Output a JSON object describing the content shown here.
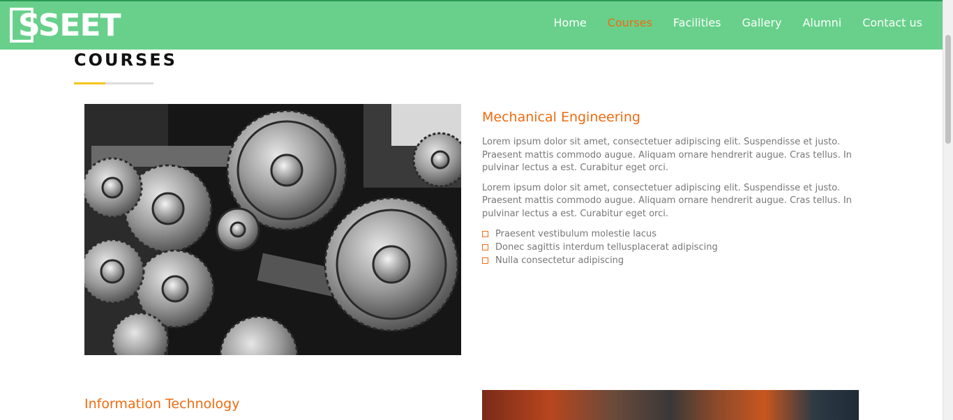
{
  "brand": {
    "logo_text": "SSEET"
  },
  "nav": {
    "items": [
      {
        "label": "Home",
        "active": false
      },
      {
        "label": "Courses",
        "active": true
      },
      {
        "label": "Facilities",
        "active": false
      },
      {
        "label": "Gallery",
        "active": false
      },
      {
        "label": "Alumni",
        "active": false
      },
      {
        "label": "Contact us",
        "active": false
      }
    ]
  },
  "section": {
    "title": "COURSES"
  },
  "courses": [
    {
      "title": "Mechanical Engineering",
      "paragraphs": [
        "Lorem ipsum dolor sit amet, consectetuer adipiscing elit. Suspendisse et justo. Praesent mattis commodo augue. Aliquam ornare hendrerit augue. Cras tellus. In pulvinar lectus a est. Curabitur eget orci.",
        "Lorem ipsum dolor sit amet, consectetuer adipiscing elit. Suspendisse et justo. Praesent mattis commodo augue. Aliquam ornare hendrerit augue. Cras tellus. In pulvinar lectus a est. Curabitur eget orci."
      ],
      "bullets": [
        "Praesent vestibulum molestie lacus",
        "Donec sagittis interdum tellusplacerat adipiscing",
        "Nulla consectetur adipiscing"
      ],
      "image_icon": "gears-photo"
    },
    {
      "title": "Information Technology",
      "image_icon": "students-photo"
    }
  ],
  "colors": {
    "nav_bg": "#68d08b",
    "accent_orange": "#f06a0f",
    "underline_yellow": "#f5c518",
    "body_text": "#777777"
  }
}
